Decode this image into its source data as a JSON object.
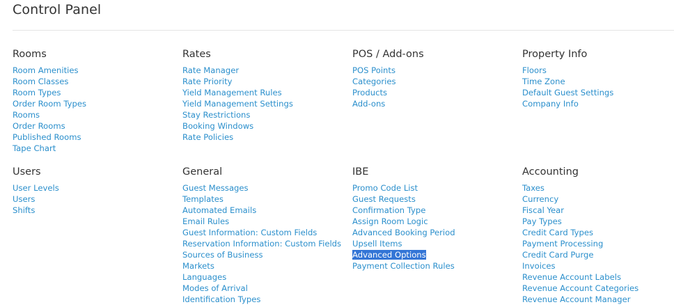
{
  "page": {
    "title": "Control Panel"
  },
  "sections": {
    "rooms": {
      "title": "Rooms",
      "items": [
        "Room Amenities",
        "Room Classes",
        "Room Types",
        "Order Room Types",
        "Rooms",
        "Order Rooms",
        "Published Rooms",
        "Tape Chart"
      ]
    },
    "rates": {
      "title": "Rates",
      "items": [
        "Rate Manager",
        "Rate Priority",
        "Yield Management Rules",
        "Yield Management Settings",
        "Stay Restrictions",
        "Booking Windows",
        "Rate Policies"
      ]
    },
    "pos": {
      "title": "POS / Add-ons",
      "items": [
        "POS Points",
        "Categories",
        "Products",
        "Add-ons"
      ]
    },
    "property": {
      "title": "Property Info",
      "items": [
        "Floors",
        "Time Zone",
        "Default Guest Settings",
        "Company Info"
      ]
    },
    "users": {
      "title": "Users",
      "items": [
        "User Levels",
        "Users",
        "Shifts"
      ]
    },
    "general": {
      "title": "General",
      "items": [
        "Guest Messages",
        "Templates",
        "Automated Emails",
        "Email Rules",
        "Guest Information: Custom Fields",
        "Reservation Information: Custom Fields",
        "Sources of Business",
        "Markets",
        "Languages",
        "Modes of Arrival",
        "Identification Types"
      ]
    },
    "ibe": {
      "title": "IBE",
      "items": [
        "Promo Code List",
        "Guest Requests",
        "Confirmation Type",
        "Assign Room Logic",
        "Advanced Booking Period",
        "Upsell Items",
        "Advanced Options",
        "Payment Collection Rules"
      ],
      "selected_item": "Advanced Options"
    },
    "accounting": {
      "title": "Accounting",
      "items": [
        "Taxes",
        "Currency",
        "Fiscal Year",
        "Pay Types",
        "Credit Card Types",
        "Payment Processing",
        "Credit Card Purge",
        "Invoices",
        "Revenue Account Labels",
        "Revenue Account Categories",
        "Revenue Account Manager"
      ]
    }
  },
  "colors": {
    "link": "#2b8fcc",
    "heading": "#333333",
    "selection_bg": "#3375d6",
    "divider": "#e5e5e5"
  }
}
